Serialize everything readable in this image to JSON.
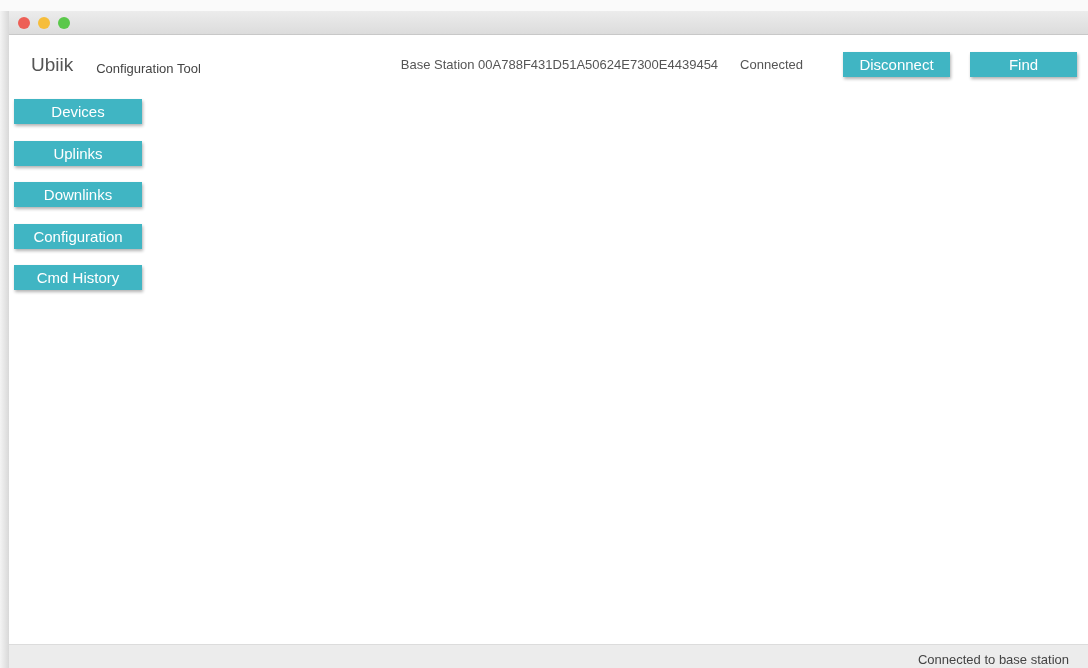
{
  "app": {
    "name": "Ubiik",
    "subtitle": "Configuration Tool"
  },
  "header": {
    "base_station": "Base Station 00A788F431D51A50624E7300E4439454",
    "connection": "Connected",
    "buttons": [
      "Disconnect",
      "Find"
    ]
  },
  "sidebar": {
    "items": [
      "Devices",
      "Uplinks",
      "Downlinks",
      "Configuration",
      "Cmd History"
    ]
  },
  "status_bar": "Connected to base station"
}
